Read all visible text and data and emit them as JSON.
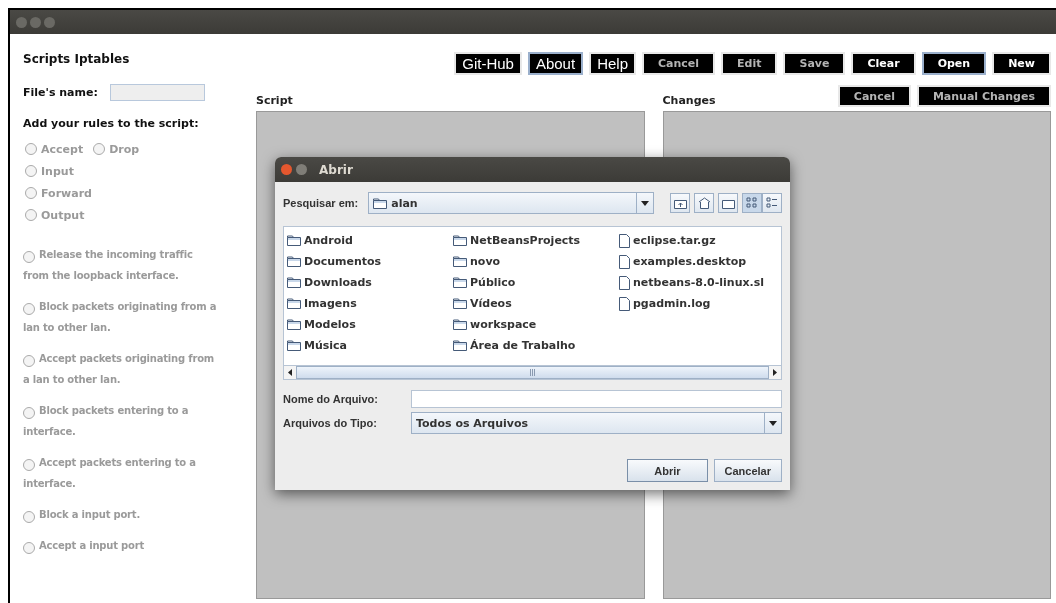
{
  "window": {
    "title": "Scripts Iptables"
  },
  "file_name": {
    "label": "File's name:"
  },
  "toolbar": [
    {
      "label": "Git-Hub",
      "kind": "large",
      "disabled": false,
      "focused": false
    },
    {
      "label": "About",
      "kind": "large",
      "disabled": false,
      "focused": true
    },
    {
      "label": "Help",
      "kind": "large",
      "disabled": false,
      "focused": false
    },
    {
      "label": "Cancel",
      "kind": "small",
      "disabled": true,
      "focused": false
    },
    {
      "label": "Edit",
      "kind": "small",
      "disabled": true,
      "focused": false
    },
    {
      "label": "Save",
      "kind": "small",
      "disabled": true,
      "focused": false
    },
    {
      "label": "Clear",
      "kind": "small",
      "disabled": false,
      "focused": false
    },
    {
      "label": "Open",
      "kind": "small",
      "disabled": false,
      "focused": true
    },
    {
      "label": "New",
      "kind": "small",
      "disabled": false,
      "focused": false
    }
  ],
  "rules_heading": "Add your rules to the script:",
  "action_rows": [
    {
      "options": [
        {
          "label": "Accept",
          "checked": false
        },
        {
          "label": "Drop",
          "checked": false
        }
      ]
    },
    {
      "options": [
        {
          "label": "Input",
          "checked": false
        }
      ]
    },
    {
      "options": [
        {
          "label": "Forward",
          "checked": false
        }
      ]
    },
    {
      "options": [
        {
          "label": "Output",
          "checked": false
        }
      ]
    }
  ],
  "rules": [
    {
      "label": "Release the incoming traffic from the loopback interface.",
      "checked": false
    },
    {
      "label": "Block packets originating from a lan to other lan.",
      "checked": false
    },
    {
      "label": "Accept packets originating from a lan to other lan.",
      "checked": false
    },
    {
      "label": "Block packets entering to a interface.",
      "checked": false
    },
    {
      "label": "Accept packets entering to a interface.",
      "checked": false
    },
    {
      "label": "Block a input port.",
      "checked": false
    },
    {
      "label": "Accept a input port",
      "checked": false
    }
  ],
  "script_panel": {
    "title": "Script"
  },
  "changes_panel": {
    "title": "Changes",
    "buttons": [
      {
        "label": "Cancel",
        "disabled": true
      },
      {
        "label": "Manual Changes",
        "disabled": true
      }
    ]
  },
  "dialog": {
    "title": "Abrir",
    "look_in": {
      "label": "Pesquisar em:",
      "value": "alan"
    },
    "columns": [
      [
        {
          "name": "Android",
          "kind": "folder"
        },
        {
          "name": "Documentos",
          "kind": "folder"
        },
        {
          "name": "Downloads",
          "kind": "folder"
        },
        {
          "name": "Imagens",
          "kind": "folder"
        },
        {
          "name": "Modelos",
          "kind": "folder"
        },
        {
          "name": "Música",
          "kind": "folder"
        }
      ],
      [
        {
          "name": "NetBeansProjects",
          "kind": "folder"
        },
        {
          "name": "novo",
          "kind": "folder"
        },
        {
          "name": "Público",
          "kind": "folder"
        },
        {
          "name": "Vídeos",
          "kind": "folder"
        },
        {
          "name": "workspace",
          "kind": "folder"
        },
        {
          "name": "Área de Trabalho",
          "kind": "folder"
        }
      ],
      [
        {
          "name": "eclipse.tar.gz",
          "kind": "file"
        },
        {
          "name": "examples.desktop",
          "kind": "file"
        },
        {
          "name": "netbeans-8.0-linux.sl",
          "kind": "file"
        },
        {
          "name": "pgadmin.log",
          "kind": "file"
        }
      ]
    ],
    "file_name": {
      "label": "Nome do Arquivo:"
    },
    "file_type": {
      "label": "Arquivos do Tipo:",
      "value": "Todos os Arquivos"
    },
    "buttons": [
      {
        "label": "Abrir",
        "kind": "default"
      },
      {
        "label": "Cancelar",
        "kind": "normal"
      }
    ]
  }
}
